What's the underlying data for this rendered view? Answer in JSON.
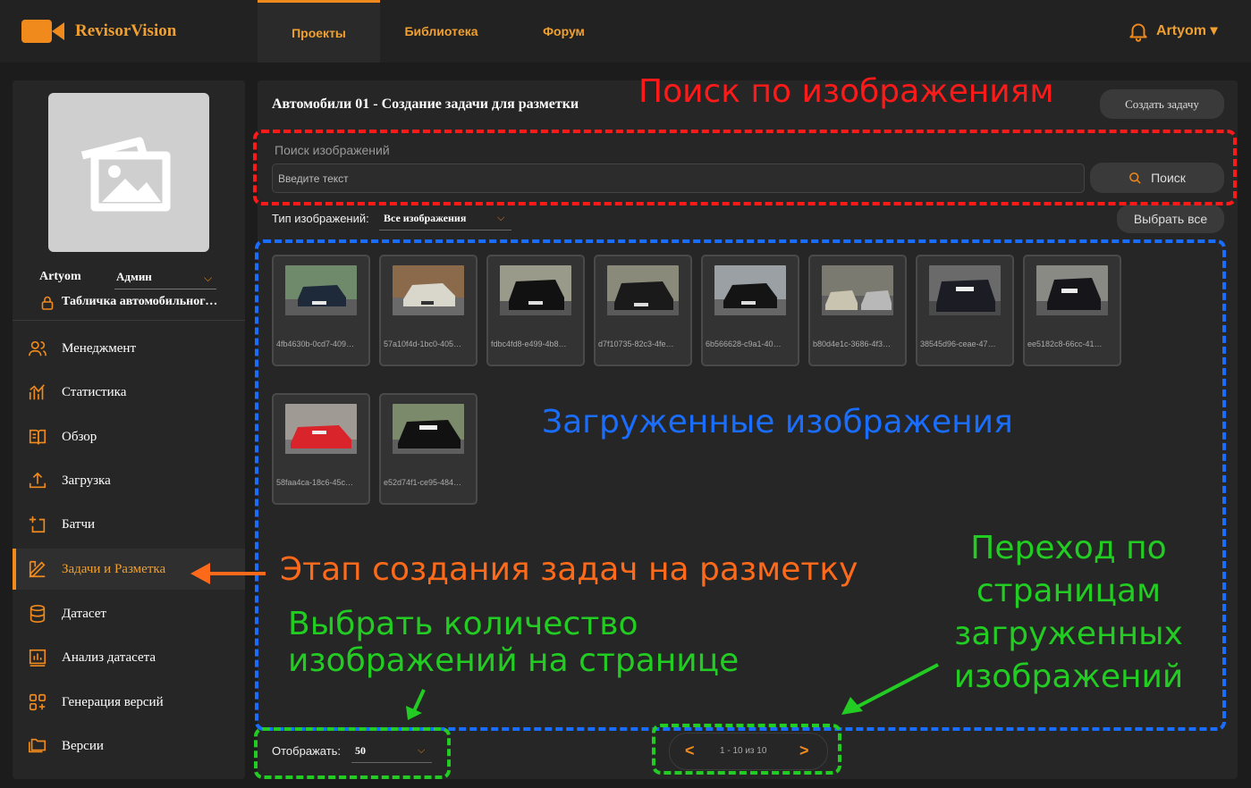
{
  "header": {
    "app_name": "RevisorVision",
    "tabs": [
      {
        "label": "Проекты",
        "active": true
      },
      {
        "label": "Библиотека",
        "active": false
      },
      {
        "label": "Форум",
        "active": false
      }
    ],
    "user": "Artyom ▾",
    "accent_color": "#f08a1c"
  },
  "sidebar": {
    "user_name": "Artyom",
    "role": "Админ",
    "project": "Табличка автомобильного номера",
    "items": [
      {
        "label": "Менеджмент",
        "icon": "users-icon"
      },
      {
        "label": "Статистика",
        "icon": "chart-icon"
      },
      {
        "label": "Обзор",
        "icon": "book-icon"
      },
      {
        "label": "Загрузка",
        "icon": "upload-icon"
      },
      {
        "label": "Батчи",
        "icon": "add-batch-icon"
      },
      {
        "label": "Задачи и Разметка",
        "icon": "pencil-ruler-icon",
        "active": true
      },
      {
        "label": "Датасет",
        "icon": "database-icon"
      },
      {
        "label": "Анализ датасета",
        "icon": "analysis-icon"
      },
      {
        "label": "Генерация версий",
        "icon": "grid-add-icon"
      },
      {
        "label": "Версии",
        "icon": "folders-icon"
      }
    ]
  },
  "main": {
    "title": "Автомобили 01 - Создание задачи для разметки",
    "create_task_label": "Создать задачу",
    "search": {
      "label": "Поиск изображений",
      "placeholder": "Введите текст",
      "button_label": "Поиск"
    },
    "filter": {
      "label": "Тип изображений:",
      "value": "Все изображения"
    },
    "select_all_label": "Выбрать все",
    "images": [
      {
        "id": "4fb4630b-0cd7-409…"
      },
      {
        "id": "57a10f4d-1bc0-405…"
      },
      {
        "id": "fdbc4fd8-e499-4b8…"
      },
      {
        "id": "d7f10735-82c3-4fe…"
      },
      {
        "id": "6b566628-c9a1-40…"
      },
      {
        "id": "b80d4e1c-3686-4f3…"
      },
      {
        "id": "38545d96-ceae-47…"
      },
      {
        "id": "ee5182c8-66cc-41…"
      },
      {
        "id": "58faa4ca-18c6-45c…"
      },
      {
        "id": "e52d74f1-ce95-484…"
      }
    ],
    "per_page": {
      "label": "Отображать:",
      "value": "50"
    },
    "pagination": {
      "prev": "<",
      "info": "1 - 10 из 10",
      "next": ">"
    }
  },
  "annotations": {
    "search": "Поиск по изображениям",
    "uploaded": "Загруженные изображения",
    "stage": "Этап создания задач на разметку",
    "count_line1": "Выбрать количество",
    "count_line2": "изображений на странице",
    "pages_line1": "Переход по",
    "pages_line2": "страницам",
    "pages_line3": "загруженных",
    "pages_line4": "изображений"
  }
}
